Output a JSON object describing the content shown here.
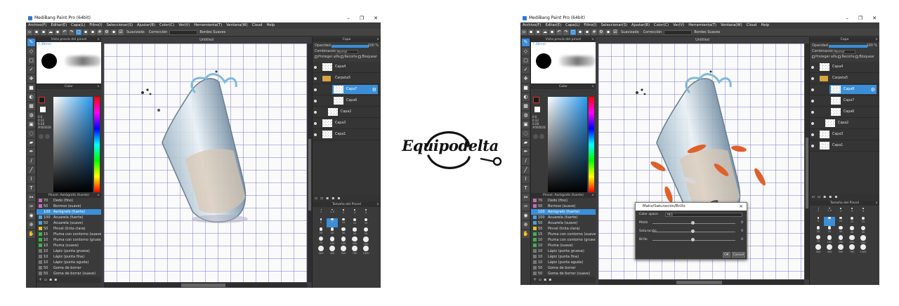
{
  "app": {
    "title": "MediBang Paint Pro (64bit)",
    "menu": [
      "Archivo(F)",
      "Editar(E)",
      "Capa(L)",
      "Filtro(I)",
      "Seleccionar(S)",
      "Ajustar(B)",
      "Color(C)",
      "Ver(V)",
      "Herramienta(T)",
      "Ventana(W)",
      "Cloud",
      "Help"
    ],
    "toolbar": {
      "suavizado_label": "Suavizado",
      "correccion_label": "Corrección",
      "bordes_label": "Bordes Suaves",
      "correccion_value": "10"
    },
    "doc_tab": "Untitled"
  },
  "panels": {
    "brush_preview_title": "Vista previa del pincel",
    "brush_size": "7.38mm",
    "color_title": "Color",
    "color_values": [
      "0:0",
      "0:32",
      "0:28",
      "#000028"
    ],
    "brush_list_title": "Pincel: Aerógrafo (fuerte)",
    "brushes": [
      {
        "size": "70",
        "name": "Dedo (fino)",
        "color": "#c76ab8"
      },
      {
        "size": "50",
        "name": "Borroso (suave)",
        "color": "#c76ab8"
      },
      {
        "size": "100",
        "name": "Aerógrafo (fuerte)",
        "color": "#3b8fd8"
      },
      {
        "size": "100",
        "name": "Acuarela (fuerte)",
        "color": "#4aa3df"
      },
      {
        "size": "50",
        "name": "Acuarela (suave)",
        "color": "#4aa3df"
      },
      {
        "size": "50",
        "name": "Pincel (tinta clara)",
        "color": "#e0c030"
      },
      {
        "size": "15",
        "name": "Pluma con contorno (suave)",
        "color": "#3fb34f"
      },
      {
        "size": "10",
        "name": "Pluma con contorno (grueso)",
        "color": "#3fb34f"
      },
      {
        "size": "10",
        "name": "Pluma (suave)",
        "color": "#3fb34f"
      },
      {
        "size": "10",
        "name": "Lápiz (punta gruesa)",
        "color": "#777777"
      },
      {
        "size": "10",
        "name": "Lápiz (punta fina)",
        "color": "#777777"
      },
      {
        "size": "10",
        "name": "Lápiz (punta aguda)",
        "color": "#777777"
      },
      {
        "size": "50",
        "name": "Goma de borrar",
        "color": "#777777"
      },
      {
        "size": "50",
        "name": "Goma de borrar (suave)",
        "color": "#777777"
      }
    ],
    "brush_selected_index": 2,
    "layer_title": "Capa",
    "opacity_label": "Opacidad",
    "opacity_value": "100 %",
    "opacity_fraction": 1.0,
    "blend_label": "Combinación",
    "blend_value": "Normal",
    "protect_label": "Proteger alfa",
    "clip_label": "Recorte",
    "lock_label": "Bloquear",
    "size_title": "Tamaño del Pincel",
    "size_labels": [
      "1",
      "1.5",
      "2",
      "3",
      "4",
      "5",
      "7",
      "10",
      "12",
      "15",
      "20",
      "25",
      "30",
      "40",
      "50",
      "70",
      "100",
      "150",
      "200",
      "250",
      "300",
      "400",
      "500",
      "700",
      "1000"
    ]
  },
  "left_shot": {
    "layers": [
      {
        "name": "Capa4",
        "kind": "layer",
        "indent": 0,
        "selected": false
      },
      {
        "name": "Carpeta5",
        "kind": "folder",
        "indent": 0,
        "selected": false
      },
      {
        "name": "Capa7",
        "kind": "layer",
        "indent": 2,
        "selected": true
      },
      {
        "name": "Capa6",
        "kind": "layer",
        "indent": 2,
        "selected": false
      },
      {
        "name": "Capa2",
        "kind": "layer",
        "indent": 1,
        "selected": false
      },
      {
        "name": "Capa3",
        "kind": "layer",
        "indent": 0,
        "selected": false
      },
      {
        "name": "Capa1",
        "kind": "layer",
        "indent": 0,
        "selected": false
      }
    ]
  },
  "right_shot": {
    "layers": [
      {
        "name": "Capa4",
        "kind": "layer",
        "indent": 0,
        "selected": false
      },
      {
        "name": "Carpeta5",
        "kind": "folder",
        "indent": 0,
        "selected": false
      },
      {
        "name": "Capa8",
        "kind": "layer",
        "indent": 2,
        "selected": true
      },
      {
        "name": "Capa7",
        "kind": "layer",
        "indent": 2,
        "selected": false
      },
      {
        "name": "Capa6",
        "kind": "layer",
        "indent": 2,
        "selected": false
      },
      {
        "name": "Capa2",
        "kind": "layer",
        "indent": 1,
        "selected": false
      },
      {
        "name": "Capa3",
        "kind": "layer",
        "indent": 0,
        "selected": false
      },
      {
        "name": "Capa1",
        "kind": "layer",
        "indent": 0,
        "selected": false
      }
    ],
    "dialog": {
      "title": "Matiz/Saturación/Brillo",
      "space_label": "Color space",
      "space_value": "HLS",
      "sliders": [
        {
          "label": "Matiz",
          "value": "0"
        },
        {
          "label": "Saturación",
          "value": "0"
        },
        {
          "label": "Brillo",
          "value": "0"
        }
      ],
      "ok_label": "OK",
      "cancel_label": "Cancel"
    }
  },
  "logo_text": "Equipodelta",
  "colors": {
    "accent": "#3b8fd8",
    "panel": "#3a3a3a",
    "canvas_bg": "#3d3d3d"
  }
}
